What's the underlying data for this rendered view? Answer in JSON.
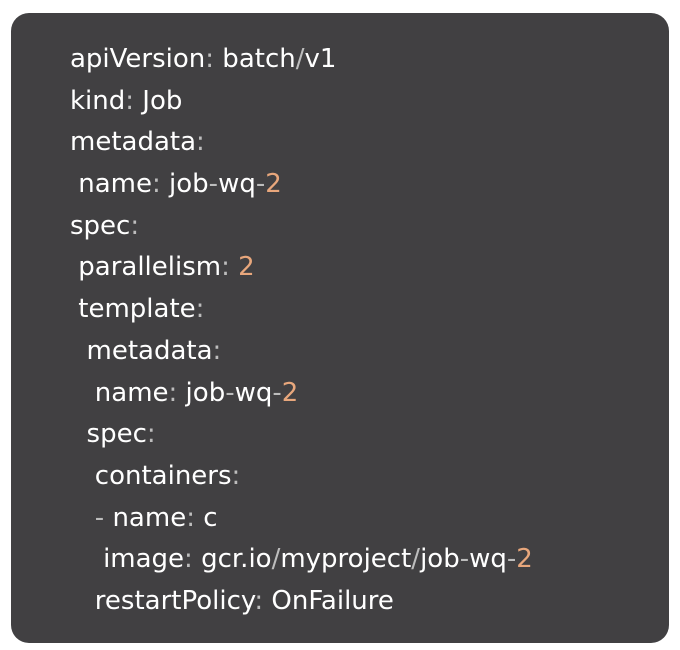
{
  "lines": [
    {
      "indent": "",
      "key": "apiVersion",
      "colon": ":",
      "parts": [
        {
          "t": " batch",
          "c": "val"
        },
        {
          "t": "/",
          "c": "punct"
        },
        {
          "t": "v1",
          "c": "val"
        }
      ]
    },
    {
      "indent": "",
      "key": "kind",
      "colon": ":",
      "parts": [
        {
          "t": " Job",
          "c": "val"
        }
      ]
    },
    {
      "indent": "",
      "key": "metadata",
      "colon": ":",
      "parts": []
    },
    {
      "indent": " ",
      "key": "name",
      "colon": ":",
      "parts": [
        {
          "t": " job",
          "c": "val"
        },
        {
          "t": "-",
          "c": "punct"
        },
        {
          "t": "wq",
          "c": "val"
        },
        {
          "t": "-",
          "c": "punct"
        },
        {
          "t": "2",
          "c": "num"
        }
      ]
    },
    {
      "indent": "",
      "key": "spec",
      "colon": ":",
      "parts": []
    },
    {
      "indent": " ",
      "key": "parallelism",
      "colon": ":",
      "parts": [
        {
          "t": " ",
          "c": "val"
        },
        {
          "t": "2",
          "c": "num"
        }
      ]
    },
    {
      "indent": " ",
      "key": "template",
      "colon": ":",
      "parts": []
    },
    {
      "indent": "  ",
      "key": "metadata",
      "colon": ":",
      "parts": []
    },
    {
      "indent": "   ",
      "key": "name",
      "colon": ":",
      "parts": [
        {
          "t": " job",
          "c": "val"
        },
        {
          "t": "-",
          "c": "punct"
        },
        {
          "t": "wq",
          "c": "val"
        },
        {
          "t": "-",
          "c": "punct"
        },
        {
          "t": "2",
          "c": "num"
        }
      ]
    },
    {
      "indent": "  ",
      "key": "spec",
      "colon": ":",
      "parts": []
    },
    {
      "indent": "   ",
      "key": "containers",
      "colon": ":",
      "parts": []
    },
    {
      "indent": "   ",
      "prefix": "- ",
      "key": "name",
      "colon": ":",
      "parts": [
        {
          "t": " c",
          "c": "val"
        }
      ]
    },
    {
      "indent": "    ",
      "key": "image",
      "colon": ":",
      "parts": [
        {
          "t": " gcr.io",
          "c": "val"
        },
        {
          "t": "/",
          "c": "punct"
        },
        {
          "t": "myproject",
          "c": "val"
        },
        {
          "t": "/",
          "c": "punct"
        },
        {
          "t": "job",
          "c": "val"
        },
        {
          "t": "-",
          "c": "punct"
        },
        {
          "t": "wq",
          "c": "val"
        },
        {
          "t": "-",
          "c": "punct"
        },
        {
          "t": "2",
          "c": "num"
        }
      ]
    },
    {
      "indent": "   ",
      "key": "restartPolicy",
      "colon": ":",
      "parts": [
        {
          "t": " OnFailure",
          "c": "val"
        }
      ]
    }
  ],
  "colors": {
    "background": "#414042",
    "text": "#ffffff",
    "punctuation": "#bdbdbd",
    "number": "#e8a77c"
  }
}
